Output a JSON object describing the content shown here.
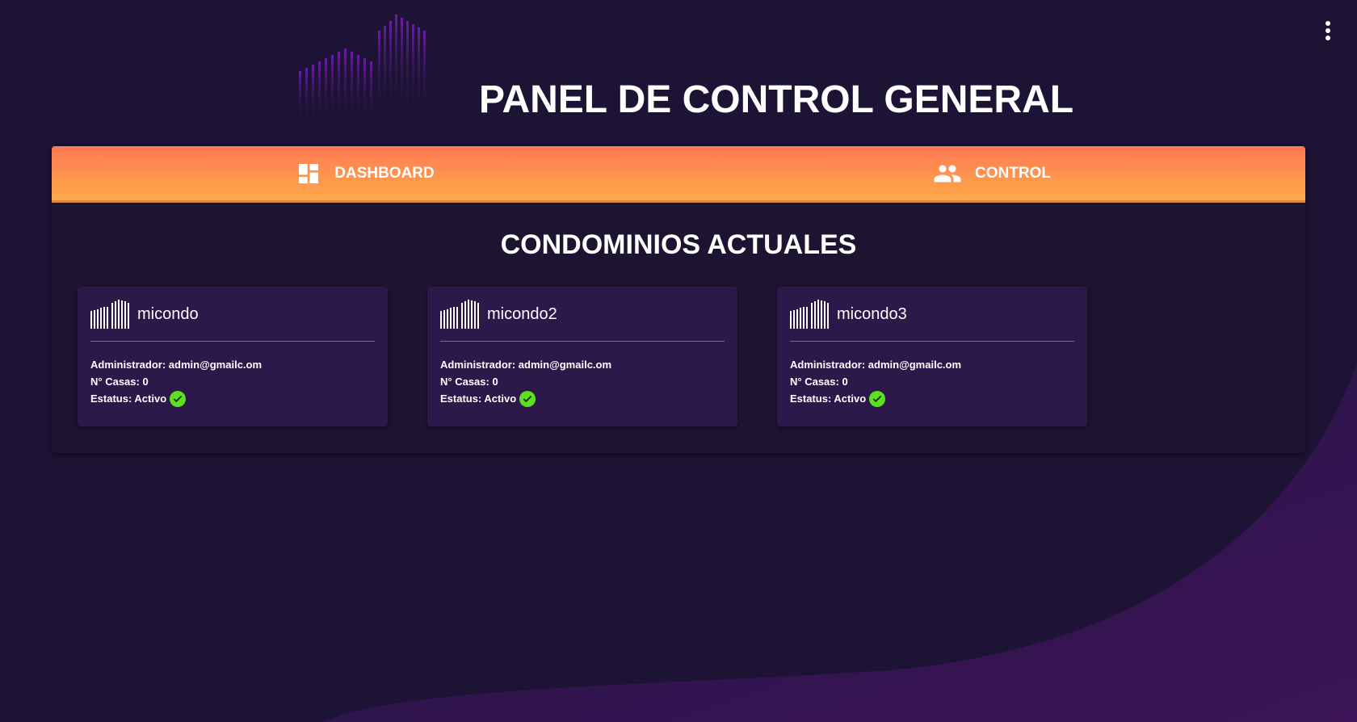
{
  "header": {
    "title": "PANEL DE CONTROL GENERAL"
  },
  "tabs": [
    {
      "label": "DASHBOARD",
      "icon": "dashboard-icon"
    },
    {
      "label": "CONTROL",
      "icon": "people-icon"
    }
  ],
  "section": {
    "heading": "CONDOMINIOS ACTUALES"
  },
  "condos": [
    {
      "name": "micondo",
      "admin": "Administrador: admin@gmailc.om",
      "casas": "N° Casas: 0",
      "status": "Estatus: Activo"
    },
    {
      "name": "micondo2",
      "admin": "Administrador: admin@gmailc.om",
      "casas": "N° Casas: 0",
      "status": "Estatus: Activo"
    },
    {
      "name": "micondo3",
      "admin": "Administrador: admin@gmailc.om",
      "casas": "N° Casas: 0",
      "status": "Estatus: Activo"
    }
  ],
  "colors": {
    "background": "#1d1334",
    "tab_gradient_top": "#ff7a52",
    "tab_gradient_bottom": "#ffa84a",
    "card": "#2c1849",
    "status_ok": "#5be21c"
  }
}
